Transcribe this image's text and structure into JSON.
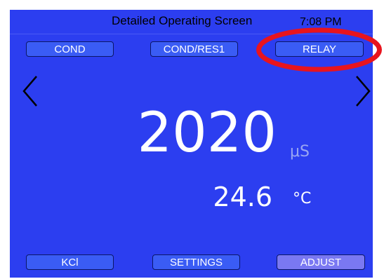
{
  "header": {
    "title": "Detailed Operating Screen",
    "time": "7:08 PM"
  },
  "top_buttons": [
    {
      "label": "COND",
      "active": false
    },
    {
      "label": "COND/RES1",
      "active": false
    },
    {
      "label": "RELAY",
      "active": false
    }
  ],
  "reading": {
    "main_value": "2020",
    "main_unit": "μS",
    "temperature_value": "24.6",
    "temperature_unit": "°C"
  },
  "bottom_buttons": [
    {
      "label": "KCl",
      "active": false
    },
    {
      "label": "SETTINGS",
      "active": false
    },
    {
      "label": "ADJUST",
      "active": true
    }
  ],
  "colors": {
    "screen_background": "#2c3ef0",
    "button_background": "#3a5cf5",
    "button_active": "#7a78f2",
    "highlight_ring": "#e8141e"
  },
  "icons": {
    "left_nav": "chevron-left-icon",
    "right_nav": "chevron-right-icon"
  }
}
